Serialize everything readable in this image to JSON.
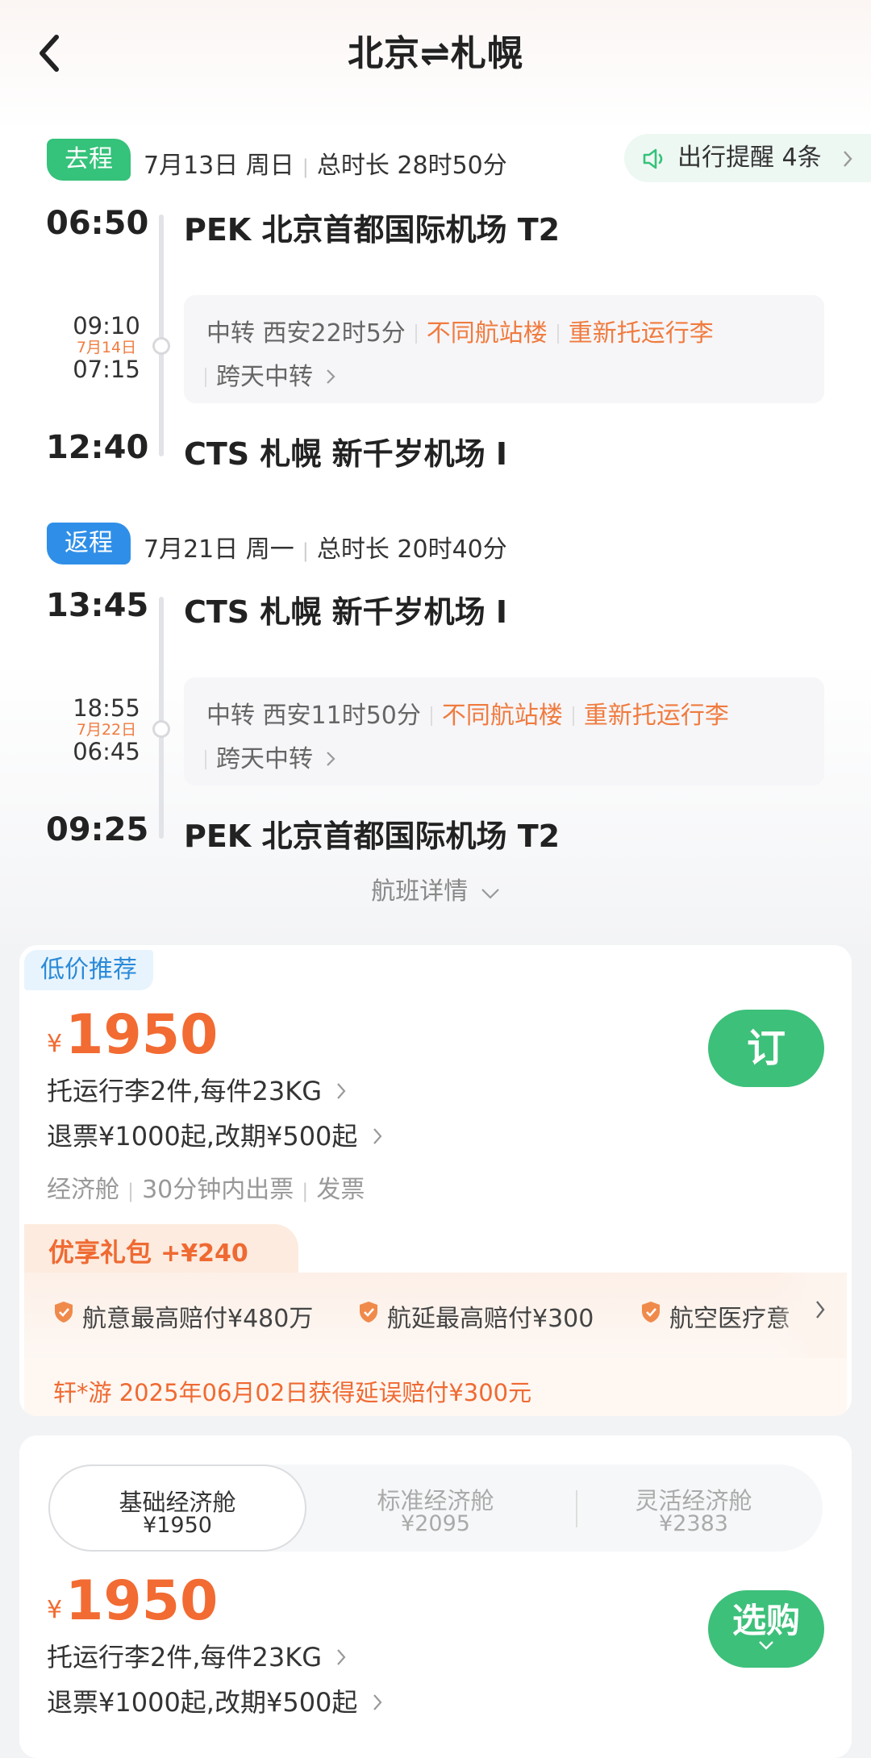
{
  "header": {
    "title": "北京⇌札幌"
  },
  "outbound": {
    "tag": "去程",
    "date": "7月13日 周日",
    "duration": "总时长 28时50分",
    "reminder": "出行提醒 4条",
    "depart": {
      "time": "06:50",
      "airport": "PEK 北京首都国际机场 T2"
    },
    "transfer": {
      "arrive": "09:10",
      "next_day": "7月14日",
      "leave": "07:15",
      "city": "中转 西安22时5分",
      "terminal": "不同航站楼",
      "baggage": "重新托运行李",
      "overnight": "跨天中转"
    },
    "arrive": {
      "time": "12:40",
      "airport": "CTS 札幌 新千岁机场 I"
    }
  },
  "return": {
    "tag": "返程",
    "date": "7月21日 周一",
    "duration": "总时长 20时40分",
    "depart": {
      "time": "13:45",
      "airport": "CTS 札幌 新千岁机场 I"
    },
    "transfer": {
      "arrive": "18:55",
      "next_day": "7月22日",
      "leave": "06:45",
      "city": "中转 西安11时50分",
      "terminal": "不同航站楼",
      "baggage": "重新托运行李",
      "overnight": "跨天中转"
    },
    "arrive": {
      "time": "09:25",
      "airport": "PEK 北京首都国际机场 T2"
    }
  },
  "flight_detail": "航班详情",
  "offer1": {
    "tag": "低价推荐",
    "currency": "¥",
    "price": "1950",
    "baggage": "托运行李2件,每件23KG",
    "refund": "退票¥1000起,改期¥500起",
    "cabin": "经济舱",
    "ticketing": "30分钟内出票",
    "invoice": "发票",
    "book": "订",
    "gift": {
      "title": "优享礼包",
      "price": "+¥240",
      "items": [
        "航意最高赔付¥480万",
        "航延最高赔付¥300",
        "航空医疗意"
      ]
    },
    "claim": "轩*游 2025年06月02日获得延误赔付¥300元"
  },
  "offer2": {
    "tabs": [
      {
        "name": "基础经济舱",
        "price": "¥1950"
      },
      {
        "name": "标准经济舱",
        "price": "¥2095"
      },
      {
        "name": "灵活经济舱",
        "price": "¥2383"
      }
    ],
    "currency": "¥",
    "price": "1950",
    "baggage": "托运行李2件,每件23KG",
    "refund": "退票¥1000起,改期¥500起",
    "select": "选购"
  },
  "colors": {
    "green": "#3dc07a",
    "orange": "#f26b32",
    "blue": "#2f8fe8"
  }
}
